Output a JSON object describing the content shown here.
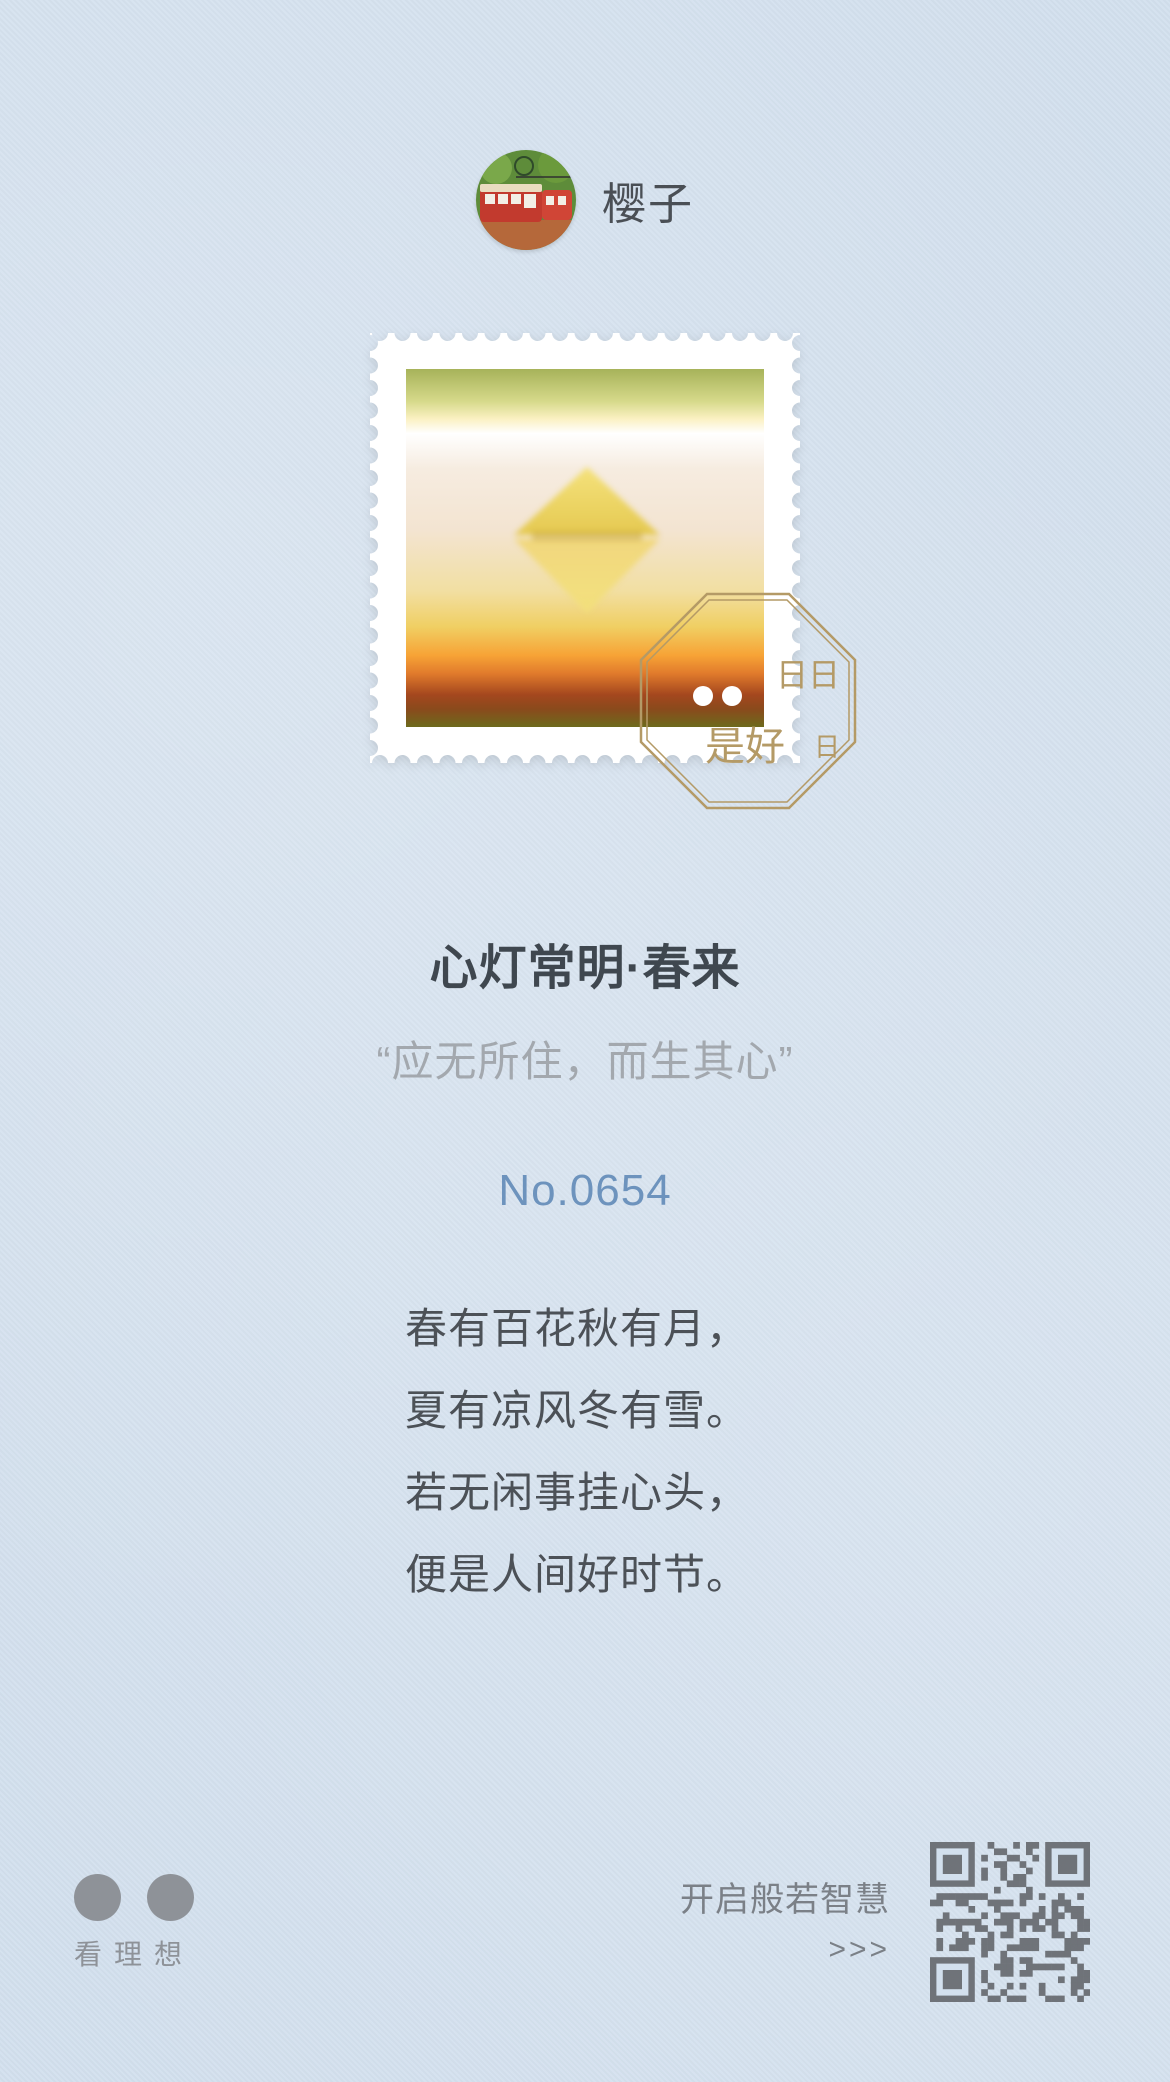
{
  "header": {
    "username": "樱子",
    "avatar_icon": "tram-avatar-icon"
  },
  "stamp": {
    "art_icon": "glowing-diamond-icon"
  },
  "postmark": {
    "text": "日日是好日",
    "color": "#b49a66"
  },
  "title": "心灯常明·春来",
  "subtitle": "“应无所住，而生其心”",
  "number": "No.0654",
  "poem": [
    "春有百花秋有月，",
    "夏有凉风冬有雪。",
    "若无闲事挂心头，",
    "便是人间好时节。"
  ],
  "footer": {
    "brand_text": "看理想",
    "cta_text": "开启般若智慧",
    "cta_arrow": ">>>",
    "qr_icon": "qr-code-icon"
  },
  "colors": {
    "background": "#d3e0ee",
    "title": "#3f474f",
    "number": "#6d93bd",
    "subtitle": "#a3a8ae"
  }
}
